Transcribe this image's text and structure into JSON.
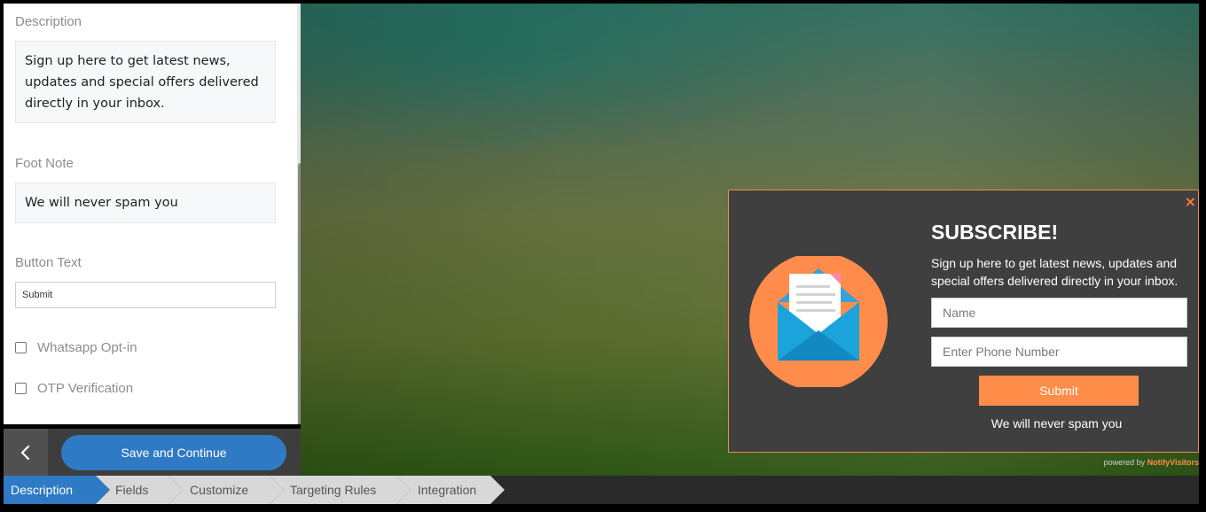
{
  "editor": {
    "description_label": "Description",
    "description_text": "Sign up here to get latest news, updates and special offers delivered directly in your inbox.",
    "footnote_label": "Foot Note",
    "footnote_text": "We will never spam you",
    "button_text_label": "Button Text",
    "button_text_value": "Submit",
    "whatsapp_label": "Whatsapp Opt-in",
    "whatsapp_checked": false,
    "otp_label": "OTP Verification",
    "otp_checked": false
  },
  "actions": {
    "back_icon": "chevron-left-icon",
    "save_label": "Save and Continue"
  },
  "popup": {
    "close_symbol": "×",
    "title": "SUBSCRIBE!",
    "description": "Sign up here to get latest news, updates and special offers delivered directly in your inbox.",
    "name_placeholder": "Name",
    "phone_placeholder": "Enter Phone Number",
    "submit_label": "Submit",
    "footnote": "We will never spam you",
    "illustration_icon": "envelope-icon"
  },
  "powered_by": {
    "prefix": "powered by",
    "brand": "NotifyVisitors"
  },
  "steps": [
    {
      "label": "Description",
      "active": true
    },
    {
      "label": "Fields",
      "active": false
    },
    {
      "label": "Customize",
      "active": false
    },
    {
      "label": "Targeting Rules",
      "active": false
    },
    {
      "label": "Integration",
      "active": false
    }
  ],
  "colors": {
    "accent": "#2f7ac4",
    "popup_accent": "#ff8c48",
    "popup_background": "#3f3f3f"
  }
}
